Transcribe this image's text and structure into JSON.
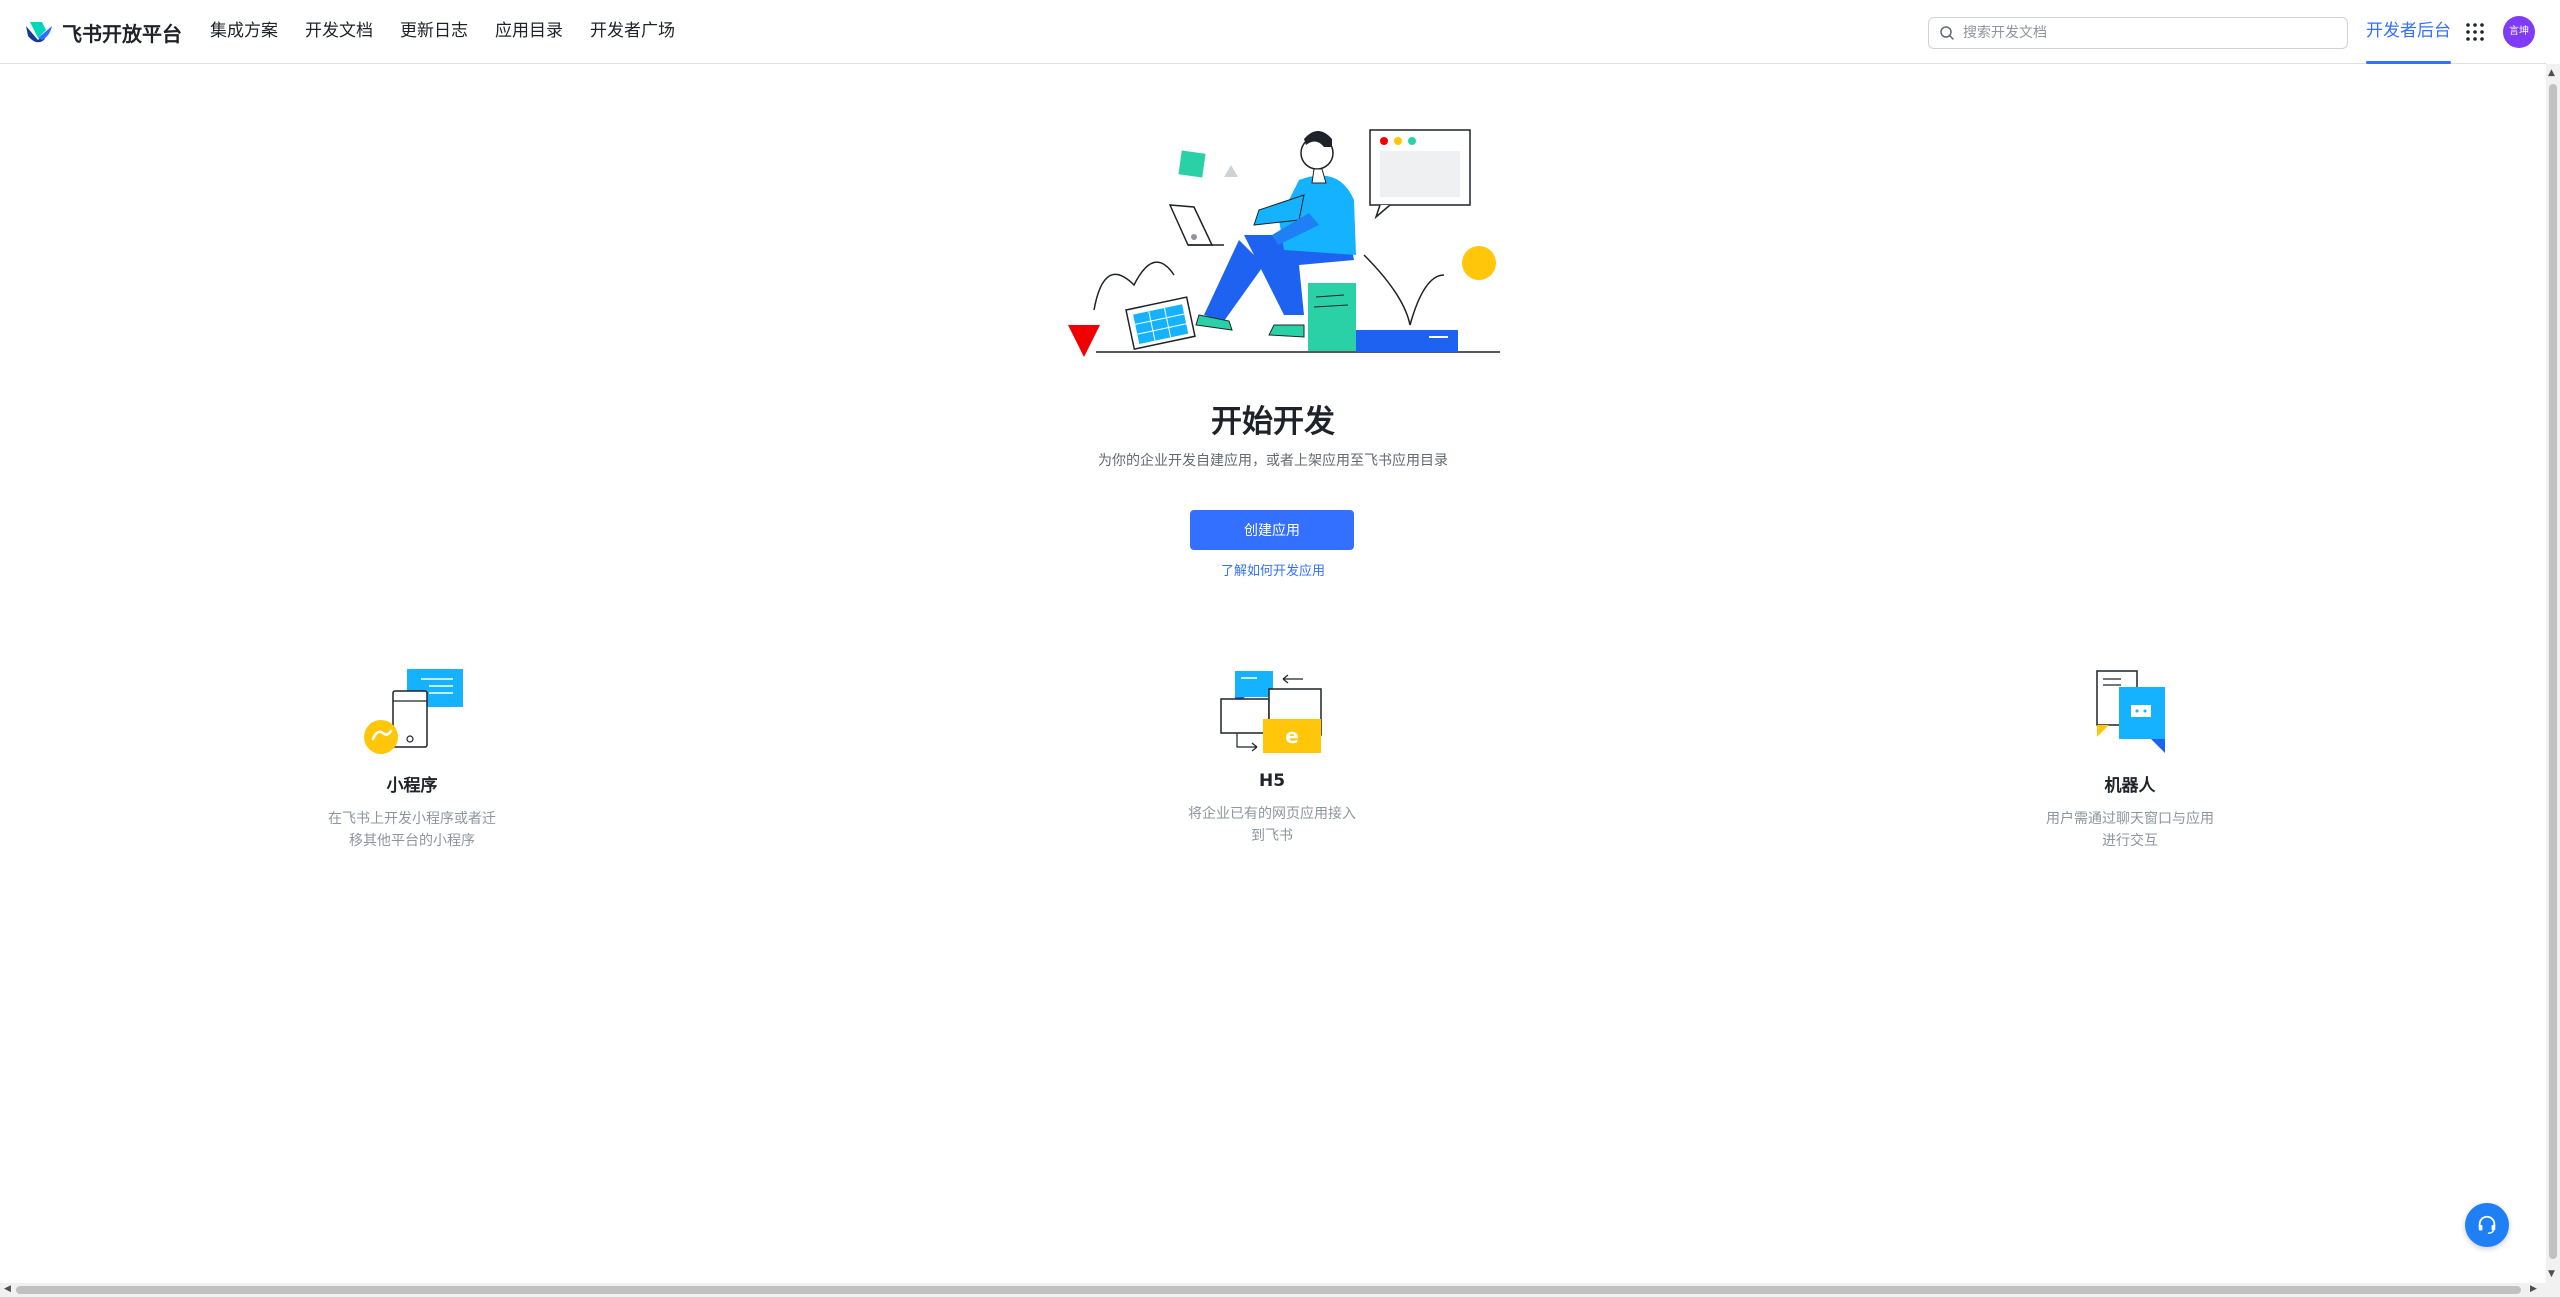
{
  "header": {
    "logo_text": "飞书开放平台",
    "nav": [
      "集成方案",
      "开发文档",
      "更新日志",
      "应用目录",
      "开发者广场"
    ],
    "search_placeholder": "搜索开发文档",
    "console_link": "开发者后台",
    "avatar_text": "言坤",
    "accent_color": "#3370ff"
  },
  "hero": {
    "title": "开始开发",
    "subtitle": "为你的企业开发自建应用，或者上架应用至飞书应用目录",
    "create_button": "创建应用",
    "learn_link": "了解如何开发应用"
  },
  "features": [
    {
      "title": "小程序",
      "desc": "在飞书上开发小程序或者迁移其他平台的小程序",
      "icon": "mini-program-icon"
    },
    {
      "title": "H5",
      "desc": "将企业已有的网页应用接入到飞书",
      "icon": "h5-icon"
    },
    {
      "title": "机器人",
      "desc": "用户需通过聊天窗口与应用进行交互",
      "icon": "bot-icon"
    }
  ],
  "icons": {
    "search": "search-icon",
    "apps": "apps-grid-icon",
    "help": "headset-icon"
  }
}
